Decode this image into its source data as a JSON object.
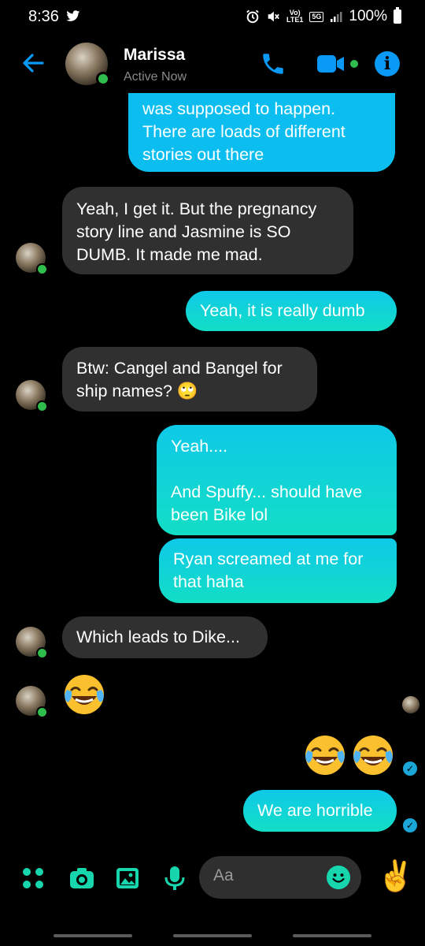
{
  "status_bar": {
    "time": "8:36",
    "battery_text": "100%",
    "network_top": "Vo)",
    "network_bottom": "LTE1",
    "net_5g": "5G"
  },
  "header": {
    "contact_name": "Marissa",
    "contact_status": "Active Now",
    "info_glyph": "i"
  },
  "messages": [
    {
      "id": "m1",
      "direction": "outgoing",
      "lines": [
        "was supposed to happen.",
        "There are loads of different",
        "stories out there"
      ]
    },
    {
      "id": "m2",
      "direction": "incoming",
      "lines": [
        "Yeah, I get it. But the pregnancy",
        "story line and Jasmine is SO",
        "DUMB. It made me mad."
      ]
    },
    {
      "id": "m3",
      "direction": "outgoing",
      "lines": [
        "Yeah, it is really dumb"
      ]
    },
    {
      "id": "m4",
      "direction": "incoming",
      "lines": [
        "Btw: Cangel and Bangel for",
        "ship names? 🙄"
      ]
    },
    {
      "id": "m5",
      "direction": "outgoing",
      "lines": [
        "Yeah....",
        "",
        "And Spuffy... should have",
        "been Bike lol"
      ]
    },
    {
      "id": "m6",
      "direction": "outgoing",
      "lines": [
        "Ryan screamed at me for",
        "that haha"
      ]
    },
    {
      "id": "m7",
      "direction": "incoming",
      "lines": [
        "Which leads to Dike..."
      ]
    },
    {
      "id": "m8",
      "direction": "incoming",
      "emoji": "face-with-tears-of-joy",
      "count": 1
    },
    {
      "id": "m9",
      "direction": "outgoing",
      "emoji": "face-with-tears-of-joy",
      "count": 2
    },
    {
      "id": "m10",
      "direction": "outgoing",
      "lines": [
        "We are horrible"
      ]
    }
  ],
  "composer": {
    "placeholder": "Aa",
    "peace_emoji": "✌️"
  },
  "icons": {
    "back": "back-arrow-icon",
    "phone": "phone-icon",
    "video": "video-camera-icon",
    "info": "info-icon",
    "apps": "apps-grid-icon",
    "camera": "camera-icon",
    "gallery": "gallery-icon",
    "mic": "microphone-icon",
    "emoji": "emoji-icon"
  },
  "colors": {
    "accent_blue": "#0a9af5",
    "outgoing_bubble": "#12d9cc",
    "incoming_bubble": "#303030",
    "composer_icons": "#17d6ad",
    "online": "#2fbd4e"
  }
}
